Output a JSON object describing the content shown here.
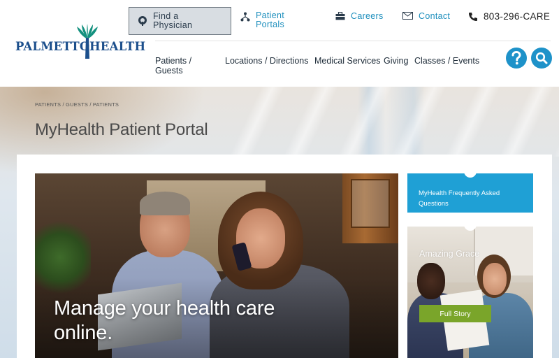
{
  "brand": {
    "name_part1": "PALMETTO",
    "name_part2": "HEALTH",
    "color": "#1c4f8c",
    "accent": "#1e92c9"
  },
  "utility": {
    "find_physician": {
      "label_line1": "Find a",
      "label_line2": "Physician",
      "icon": "stethoscope-icon"
    },
    "patient_portals": {
      "label_line1": "Patient",
      "label_line2": "Portals",
      "icon": "network-icon"
    },
    "careers": {
      "label": "Careers",
      "icon": "briefcase-icon"
    },
    "contact": {
      "label": "Contact",
      "icon": "envelope-icon"
    },
    "phone": {
      "label": "803-296-CARE",
      "icon": "phone-icon"
    }
  },
  "nav": {
    "items": [
      {
        "label_line1": "Patients /",
        "label_line2": "Guests"
      },
      {
        "label": "Locations / Directions"
      },
      {
        "label": "Medical Services"
      },
      {
        "label": "Giving"
      },
      {
        "label": "Classes / Events"
      }
    ],
    "help_icon": "question-icon",
    "search_icon": "search-icon"
  },
  "page": {
    "breadcrumb": "PATIENTS / GUESTS / PATIENTS",
    "title": "MyHealth Patient Portal"
  },
  "hero": {
    "caption_line1": "Manage your health care",
    "caption_line2": "online."
  },
  "sidebar": {
    "faq_label": "MyHealth Frequently Asked Questions",
    "story_title": "Amazing Grace",
    "story_button": "Full Story",
    "faq_color": "#1fa0d5",
    "button_color": "#7aa52a"
  }
}
